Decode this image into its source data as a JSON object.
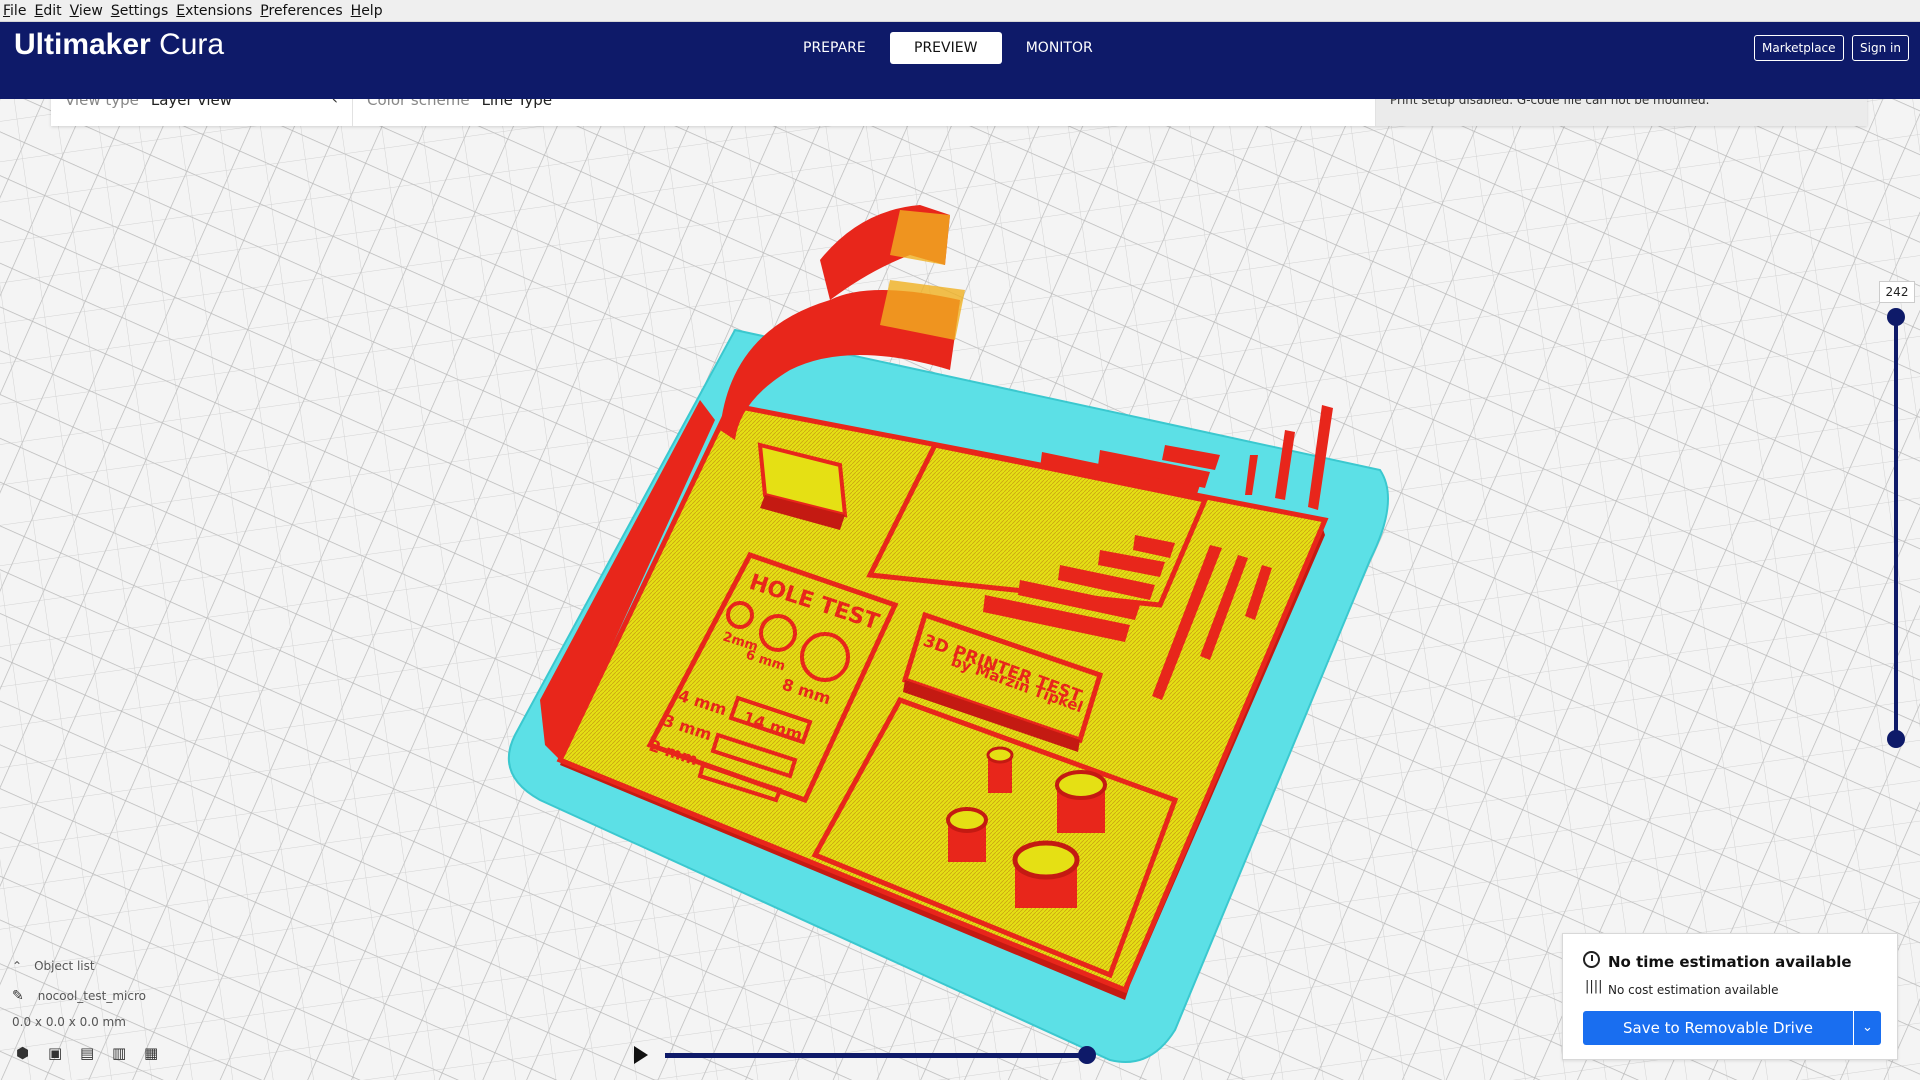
{
  "menu": [
    "File",
    "Edit",
    "View",
    "Settings",
    "Extensions",
    "Preferences",
    "Help"
  ],
  "app": {
    "brand_bold": "Ultimaker",
    "brand_light": " Cura"
  },
  "stages": {
    "prepare": "PREPARE",
    "preview": "PREVIEW",
    "monitor": "MONITOR"
  },
  "header_buttons": {
    "marketplace": "Marketplace",
    "signin": "Sign in"
  },
  "viewbar": {
    "view_type_label": "View type",
    "view_type_value": "Layer view",
    "color_scheme_label": "Color scheme",
    "color_scheme_value": "Line Type",
    "note": "Print setup disabled. G-code file can not be modified."
  },
  "layer_slider": {
    "top_label": "242"
  },
  "object_list": {
    "label": "Object list",
    "filename": "nocool_test_micro",
    "dimensions": "0.0 x 0.0 x 0.0 mm"
  },
  "model_text": {
    "hole_test": "HOLE TEST",
    "mm4": "4 mm",
    "mm3": "3 mm",
    "mm2": "2 mm",
    "mm8": "8 mm",
    "mm14": "14 mm",
    "mm6": "6 mm",
    "mm2b": "2mm",
    "printer_test": "3D PRINTER TEST",
    "by": "by Marzin Tipkel"
  },
  "print_panel": {
    "time": "No time estimation available",
    "cost": "No cost estimation available",
    "save": "Save to Removable Drive"
  },
  "colors": {
    "header": "#0e1a69",
    "accent": "#196ef0",
    "model_wall": "#e8261b",
    "model_infill": "#e5e014",
    "skirt": "#5ce0e6"
  }
}
